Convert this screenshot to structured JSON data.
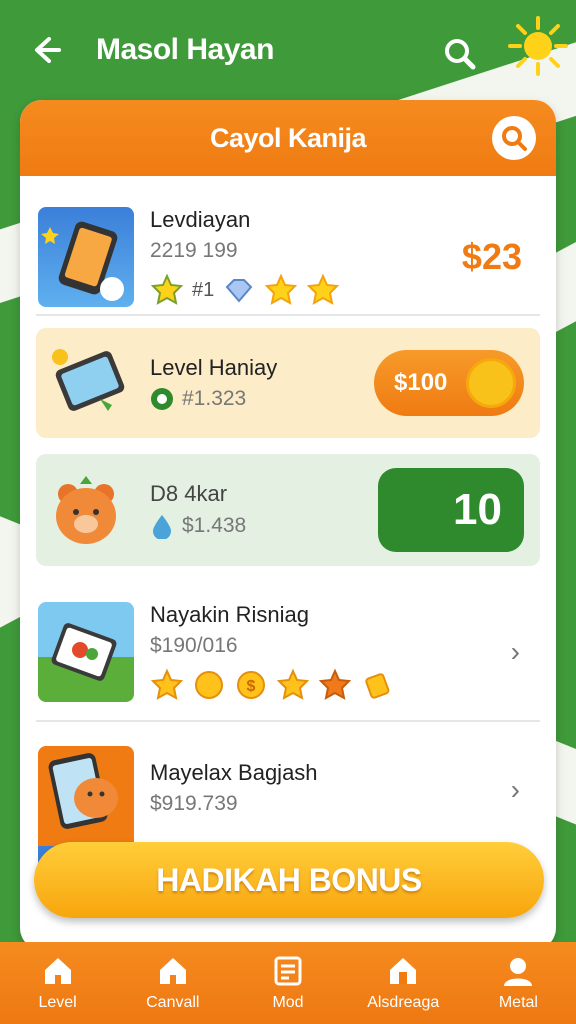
{
  "header": {
    "title": "Masol Hayan"
  },
  "panel": {
    "title": "Cayol Kanija"
  },
  "items": [
    {
      "name": "Levdiayan",
      "sub": "2219 199",
      "badge": "#1",
      "price": "$23"
    },
    {
      "name": "Level Haniay",
      "sub": "#1.323",
      "pill": "$100"
    },
    {
      "name": "D8 4kar",
      "sub": "$1.438",
      "pill": "10"
    },
    {
      "name": "Nayakin Risniag",
      "sub": "$190/016",
      "chevron": "›"
    },
    {
      "name": "Mayelax Bagjash",
      "sub": "$919.739",
      "chevron": "›"
    }
  ],
  "bonus_button": "HADIKAH BONUS",
  "tabs": [
    {
      "label": "Level",
      "icon": "home-icon"
    },
    {
      "label": "Canvall",
      "icon": "home-icon"
    },
    {
      "label": "Mod",
      "icon": "document-icon"
    },
    {
      "label": "Alsdreaga",
      "icon": "house-icon"
    },
    {
      "label": "Metal",
      "icon": "user-icon"
    }
  ],
  "colors": {
    "brand_orange": "#ef7b12",
    "brand_green": "#3f9a3a",
    "gold": "#f9c21a"
  }
}
